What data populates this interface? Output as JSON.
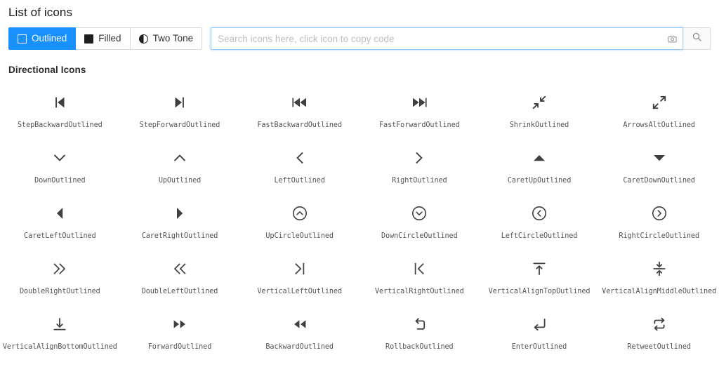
{
  "page": {
    "title": "List of icons"
  },
  "toolbar": {
    "theme_buttons": [
      {
        "label": "Outlined",
        "icon": "square-outline-icon",
        "active": true
      },
      {
        "label": "Filled",
        "icon": "square-filled-icon",
        "active": false
      },
      {
        "label": "Two Tone",
        "icon": "half-circle-icon",
        "active": false
      }
    ],
    "accent_color": "#1890ff",
    "border_color": "#d9d9d9"
  },
  "search": {
    "value": "",
    "placeholder": "Search icons here, click icon to copy code",
    "camera_icon": "camera-icon",
    "search_icon": "search-icon",
    "focus_border_color": "#8cc8ff"
  },
  "sections": [
    {
      "title": "Directional Icons",
      "icons": [
        {
          "name": "StepBackwardOutlined",
          "glyph": "step-backward"
        },
        {
          "name": "StepForwardOutlined",
          "glyph": "step-forward"
        },
        {
          "name": "FastBackwardOutlined",
          "glyph": "fast-backward"
        },
        {
          "name": "FastForwardOutlined",
          "glyph": "fast-forward"
        },
        {
          "name": "ShrinkOutlined",
          "glyph": "shrink"
        },
        {
          "name": "ArrowsAltOutlined",
          "glyph": "arrows-alt"
        },
        {
          "name": "DownOutlined",
          "glyph": "down"
        },
        {
          "name": "UpOutlined",
          "glyph": "up"
        },
        {
          "name": "LeftOutlined",
          "glyph": "left"
        },
        {
          "name": "RightOutlined",
          "glyph": "right"
        },
        {
          "name": "CaretUpOutlined",
          "glyph": "caret-up"
        },
        {
          "name": "CaretDownOutlined",
          "glyph": "caret-down"
        },
        {
          "name": "CaretLeftOutlined",
          "glyph": "caret-left"
        },
        {
          "name": "CaretRightOutlined",
          "glyph": "caret-right"
        },
        {
          "name": "UpCircleOutlined",
          "glyph": "up-circle"
        },
        {
          "name": "DownCircleOutlined",
          "glyph": "down-circle"
        },
        {
          "name": "LeftCircleOutlined",
          "glyph": "left-circle"
        },
        {
          "name": "RightCircleOutlined",
          "glyph": "right-circle"
        },
        {
          "name": "DoubleRightOutlined",
          "glyph": "double-right"
        },
        {
          "name": "DoubleLeftOutlined",
          "glyph": "double-left"
        },
        {
          "name": "VerticalLeftOutlined",
          "glyph": "vertical-left"
        },
        {
          "name": "VerticalRightOutlined",
          "glyph": "vertical-right"
        },
        {
          "name": "VerticalAlignTopOutlined",
          "glyph": "vertical-align-top"
        },
        {
          "name": "VerticalAlignMiddleOutlined",
          "glyph": "vertical-align-middle"
        },
        {
          "name": "VerticalAlignBottomOutlined",
          "glyph": "vertical-align-bottom"
        },
        {
          "name": "ForwardOutlined",
          "glyph": "forward"
        },
        {
          "name": "BackwardOutlined",
          "glyph": "backward"
        },
        {
          "name": "RollbackOutlined",
          "glyph": "rollback"
        },
        {
          "name": "EnterOutlined",
          "glyph": "enter"
        },
        {
          "name": "RetweetOutlined",
          "glyph": "retweet"
        }
      ]
    }
  ]
}
